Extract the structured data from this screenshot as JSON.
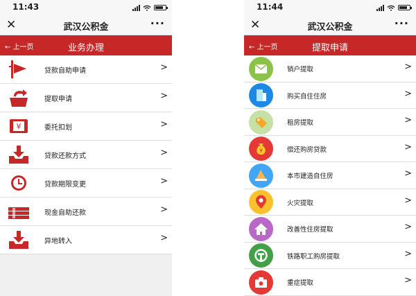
{
  "left": {
    "status_time": "11:43",
    "app_title": "武汉公积金",
    "more": "···",
    "close": "✕",
    "back_label": "上一页",
    "page_title": "业务办理",
    "items": [
      {
        "label": "贷款自助申请",
        "icon": "flag-icon"
      },
      {
        "label": "提取申请",
        "icon": "box-out-icon"
      },
      {
        "label": "委托扣划",
        "icon": "yen-card-icon"
      },
      {
        "label": "贷款还款方式",
        "icon": "tray-download-icon"
      },
      {
        "label": "贷款期限变更",
        "icon": "clock-icon"
      },
      {
        "label": "现金自助还款",
        "icon": "money-stack-icon"
      },
      {
        "label": "异地转入",
        "icon": "tray-in-icon"
      }
    ]
  },
  "right": {
    "status_time": "11:44",
    "app_title": "武汉公积金",
    "more": "···",
    "close": "✕",
    "back_label": "上一页",
    "page_title": "提取申请",
    "items": [
      {
        "label": "销户提取",
        "icon": "mail-icon",
        "color": "#8bc34a"
      },
      {
        "label": "购买自住住房",
        "icon": "building-icon",
        "color": "#1e88e5"
      },
      {
        "label": "租房提取",
        "icon": "tag-icon",
        "color": "#c5e1a5"
      },
      {
        "label": "偿还购房贷款",
        "icon": "money-bag-icon",
        "color": "#e53935"
      },
      {
        "label": "本市建造自住房",
        "icon": "construction-icon",
        "color": "#42a5f5"
      },
      {
        "label": "火灾提取",
        "icon": "fire-pin-icon",
        "color": "#fbc02d"
      },
      {
        "label": "改善性住房提取",
        "icon": "house-icon",
        "color": "#ba68c8"
      },
      {
        "label": "铁路职工购房提取",
        "icon": "railway-icon",
        "color": "#43a047"
      },
      {
        "label": "重症提取",
        "icon": "medical-kit-icon",
        "color": "#e53935"
      }
    ]
  },
  "chevron": ">"
}
